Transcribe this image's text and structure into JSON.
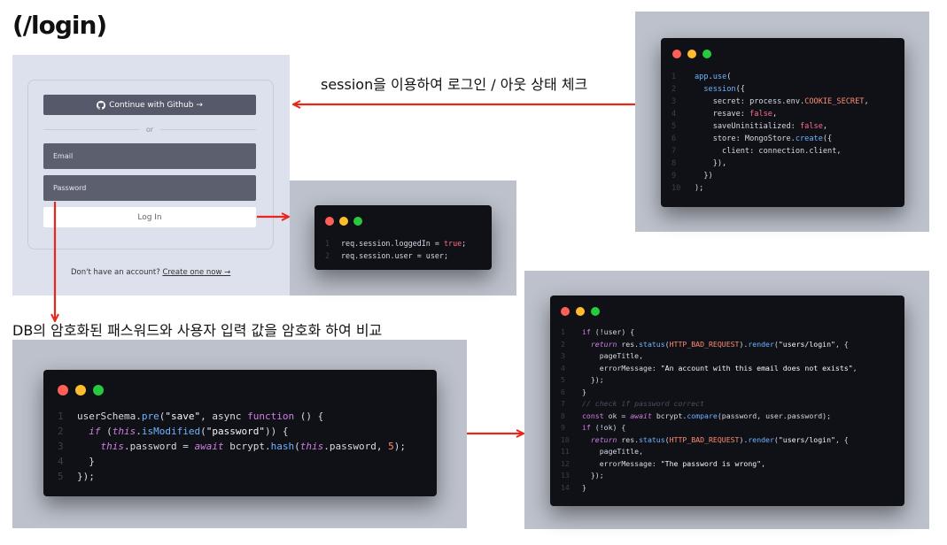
{
  "title": "(/login)",
  "captions": {
    "session": "session을 이용하여 로그인 / 아웃 상태 체크",
    "bcrypt": "DB의 암호화된 패스워드와 사용자 입력 값을 암호화 하여 비교"
  },
  "login_form": {
    "github_button": "Continue with Github →",
    "divider": "or",
    "email_placeholder": "Email",
    "password_placeholder": "Password",
    "login_button": "Log In",
    "signup_prompt": "Don't have an account?",
    "signup_link": "Create one now →"
  },
  "colors": {
    "arrow": "#e8261b",
    "code_bg": "#0f1117",
    "panel_bg": "#bcc1cb",
    "login_bg": "#dde1ee"
  },
  "code_panels": {
    "session_config": [
      "app.use(",
      "  session({",
      "    secret: process.env.COOKIE_SECRET,",
      "    resave: false,",
      "    saveUninitialized: false,",
      "    store: MongoStore.create({",
      "      client: connection.client,",
      "    }),",
      "  })",
      ");"
    ],
    "session_set": [
      "req.session.loggedIn = true;",
      "req.session.user = user;"
    ],
    "hash_hook": [
      "userSchema.pre(\"save\", async function () {",
      "  if (this.isModified(\"password\")) {",
      "    this.password = await bcrypt.hash(this.password, 5);",
      "  }",
      "});"
    ],
    "login_check": [
      "if (!user) {",
      "  return res.status(HTTP_BAD_REQUEST).render(\"users/login\", {",
      "    pageTitle,",
      "    errorMessage: \"An account with this email does not exists\",",
      "  });",
      "}",
      "// check if password correct",
      "const ok = await bcrypt.compare(password, user.password);",
      "if (!ok) {",
      "  return res.status(HTTP_BAD_REQUEST).render(\"users/login\", {",
      "    pageTitle,",
      "    errorMessage: \"The password is wrong\",",
      "  });",
      "}"
    ]
  }
}
